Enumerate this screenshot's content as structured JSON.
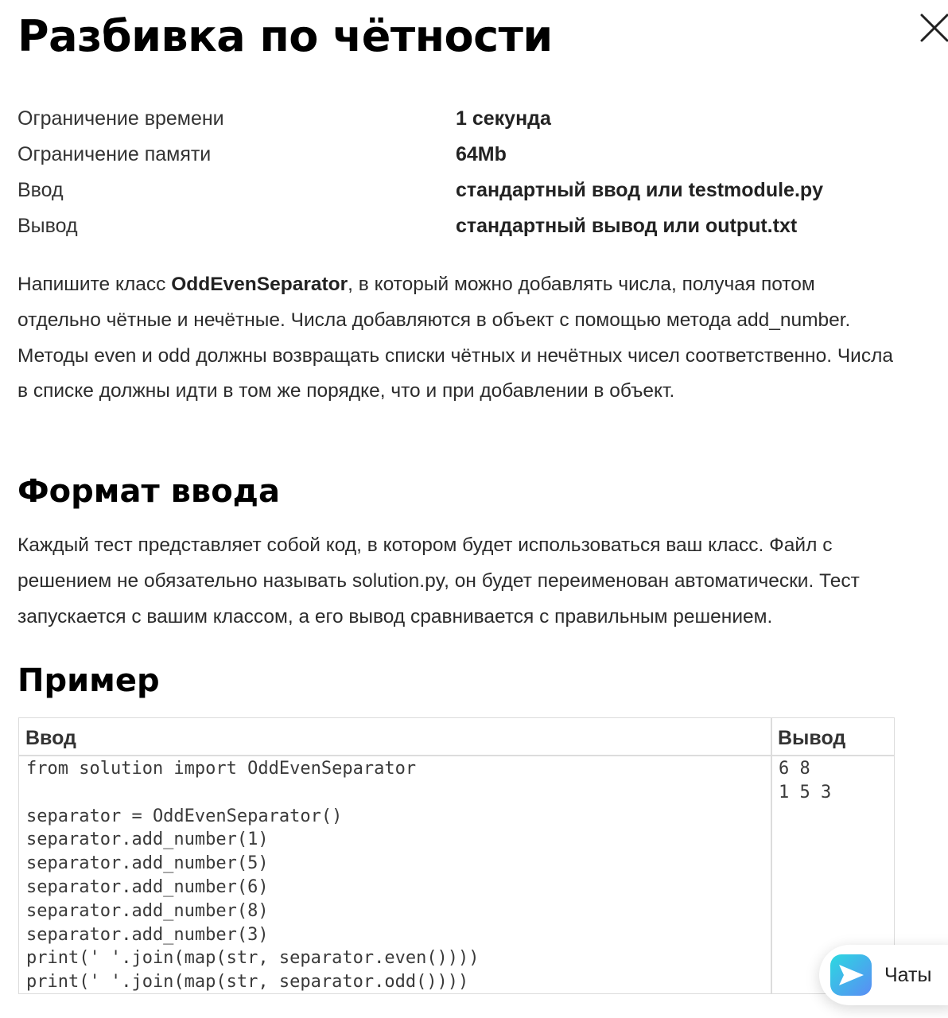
{
  "title": "Разбивка по чётности",
  "close_icon": "close-icon",
  "limits": [
    {
      "label": "Ограничение времени",
      "value": "1 секунда"
    },
    {
      "label": "Ограничение памяти",
      "value": "64Mb"
    },
    {
      "label": "Ввод",
      "value": "стандартный ввод или testmodule.py"
    },
    {
      "label": "Вывод",
      "value": "стандартный вывод или output.txt"
    }
  ],
  "legend": {
    "before": "Напишите класс ",
    "class_name": "OddEvenSeparator",
    "after": ", в который можно добавлять числа, получая потом отдельно чётные и нечётные. Числа добавляются в объект с помощью метода add_number. Методы even и odd должны возвращать списки чётных и нечётных чисел соответственно. Числа в списке должны идти в том же порядке, что и при добавлении в объект."
  },
  "input_format": {
    "heading": "Формат ввода",
    "text": "Каждый тест представляет собой код, в котором будет использоваться ваш класс. Файл с решением не обязательно называть solution.py, он будет переименован автоматически. Тест запускается с вашим классом, а его вывод сравнивается с правильным решением."
  },
  "example": {
    "heading": "Пример",
    "input_header": "Ввод",
    "output_header": "Вывод",
    "input_code": "from solution import OddEvenSeparator\n\nseparator = OddEvenSeparator()\nseparator.add_number(1)\nseparator.add_number(5)\nseparator.add_number(6)\nseparator.add_number(8)\nseparator.add_number(3)\nprint(' '.join(map(str, separator.even())))\nprint(' '.join(map(str, separator.odd())))",
    "output_code": "6 8\n1 5 3"
  },
  "chats": {
    "label": "Чаты",
    "icon": "chat-send-icon",
    "icon_gradient": [
      "#2bd9e0",
      "#5a8cf5"
    ]
  }
}
